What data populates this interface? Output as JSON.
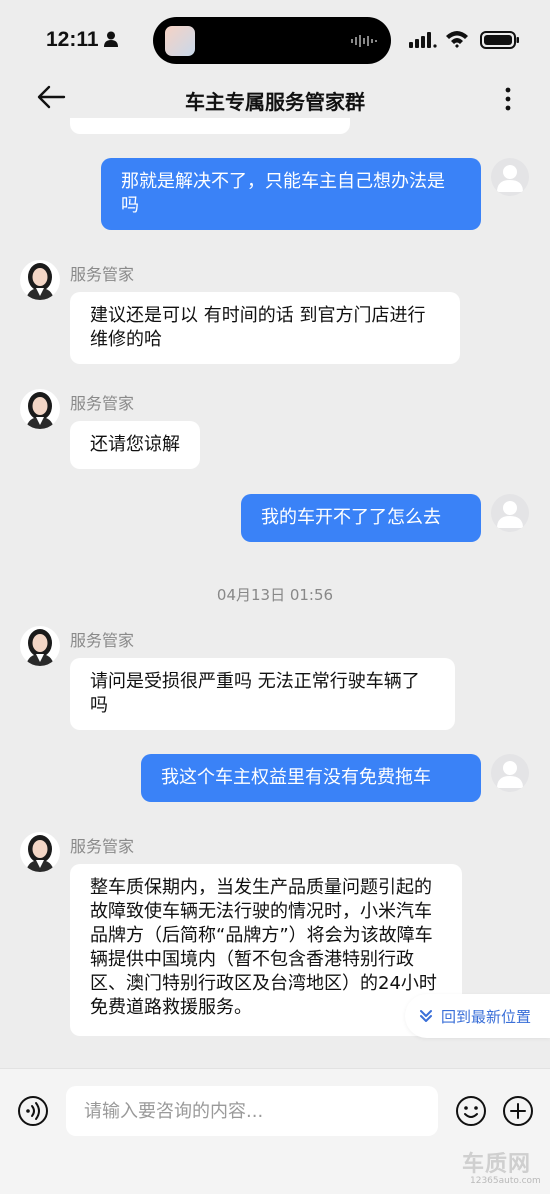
{
  "status_bar": {
    "time": "12:11"
  },
  "header": {
    "title": "车主专属服务管家群"
  },
  "messages": [
    {
      "from": "me",
      "text": "那就是解决不了，只能车主自己想办法是吗"
    },
    {
      "from": "agent",
      "sender": "服务管家",
      "text": "建议还是可以 有时间的话 到官方门店进行维修的哈"
    },
    {
      "from": "agent",
      "sender": "服务管家",
      "text": "还请您谅解"
    },
    {
      "from": "me",
      "text": "我的车开不了了怎么去"
    },
    {
      "timestamp": "04月13日 01:56"
    },
    {
      "from": "agent",
      "sender": "服务管家",
      "text": "请问是受损很严重吗 无法正常行驶车辆了吗"
    },
    {
      "from": "me",
      "text": "我这个车主权益里有没有免费拖车"
    },
    {
      "from": "agent",
      "sender": "服务管家",
      "text": "整车质保期内，当发生产品质量问题引起的故障致使车辆无法行驶的情况时，小米汽车品牌方（后简称“品牌方”）将会为该故障车辆提供中国境内（暂不包含香港特别行政区、澳门特别行政区及台湾地区）的24小时免费道路救援服务。"
    }
  ],
  "jump_latest": "回到最新位置",
  "composer": {
    "placeholder": "请输入要咨询的内容..."
  },
  "watermark": {
    "main": "车质网",
    "sub": "12365auto.com"
  },
  "colors": {
    "accent": "#3a82f7",
    "background": "#ededed"
  }
}
